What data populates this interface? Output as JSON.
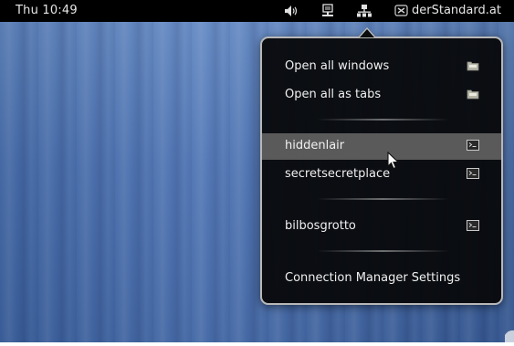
{
  "top_panel": {
    "clock": "Thu 10:49",
    "app_label": "derStandard.at"
  },
  "menu": {
    "items": [
      {
        "label": "Open all windows",
        "icon": "folder-icon"
      },
      {
        "label": "Open all as tabs",
        "icon": "folder-icon"
      },
      {
        "label": "hiddenlair",
        "icon": "terminal-icon",
        "state": "highlighted"
      },
      {
        "label": "secretsecretplace",
        "icon": "terminal-icon"
      },
      {
        "label": "bilbosgrotto",
        "icon": "terminal-icon"
      },
      {
        "label": "Connection Manager Settings"
      }
    ]
  },
  "icons": [
    "volume-icon",
    "network-icon",
    "connection-manager-icon",
    "app-icon",
    "folder-icon",
    "terminal-icon",
    "mouse-cursor-icon"
  ],
  "colors": {
    "panel": "#000000",
    "menu_background": "#08090b",
    "menu_border": "#b8b8b8",
    "highlight": "#5a5a5a",
    "wallpaper": "#4a71b2"
  }
}
